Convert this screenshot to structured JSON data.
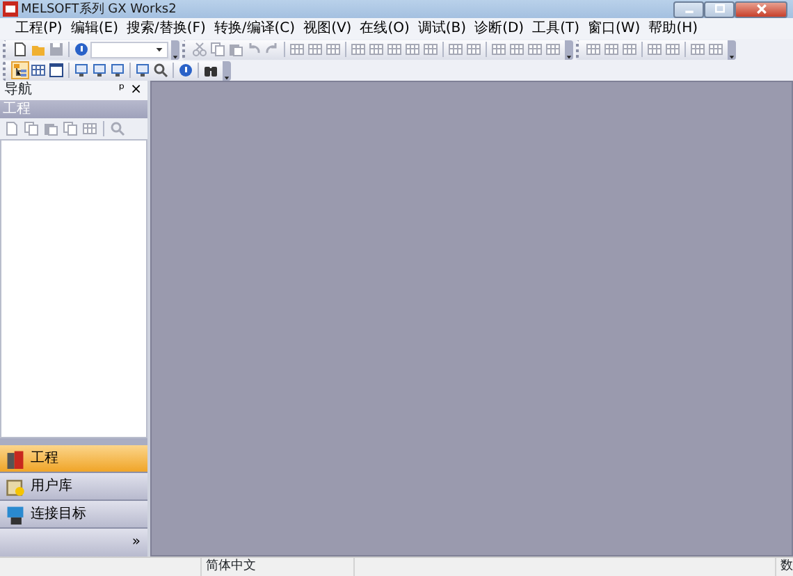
{
  "window": {
    "title": "MELSOFT系列 GX Works2"
  },
  "menu": [
    "工程(P)",
    "编辑(E)",
    "搜索/替换(F)",
    "转换/编译(C)",
    "视图(V)",
    "在线(O)",
    "调试(B)",
    "诊断(D)",
    "工具(T)",
    "窗口(W)",
    "帮助(H)"
  ],
  "toolbar_rows": [
    [
      {
        "items": [
          {
            "kind": "new",
            "disabled": false
          },
          {
            "kind": "open",
            "disabled": false
          },
          {
            "kind": "save",
            "disabled": true
          },
          {
            "kind": "sep"
          },
          {
            "kind": "help",
            "disabled": false
          },
          {
            "kind": "combo"
          }
        ]
      },
      {
        "items": [
          {
            "kind": "cut",
            "disabled": true
          },
          {
            "kind": "copy",
            "disabled": true
          },
          {
            "kind": "paste",
            "disabled": true
          },
          {
            "kind": "undo",
            "disabled": true
          },
          {
            "kind": "redo",
            "disabled": true
          },
          {
            "kind": "sep"
          },
          {
            "kind": "grid",
            "disabled": true
          },
          {
            "kind": "grid",
            "disabled": true
          },
          {
            "kind": "grid",
            "disabled": true
          },
          {
            "kind": "sep"
          },
          {
            "kind": "grid",
            "disabled": true
          },
          {
            "kind": "grid",
            "disabled": true
          },
          {
            "kind": "grid",
            "disabled": true
          },
          {
            "kind": "grid",
            "disabled": true
          },
          {
            "kind": "grid",
            "disabled": true
          },
          {
            "kind": "sep"
          },
          {
            "kind": "grid",
            "disabled": true
          },
          {
            "kind": "grid",
            "disabled": true
          },
          {
            "kind": "sep"
          },
          {
            "kind": "grid",
            "disabled": true
          },
          {
            "kind": "grid",
            "disabled": true
          },
          {
            "kind": "grid",
            "disabled": true
          },
          {
            "kind": "grid",
            "disabled": true
          }
        ]
      },
      {
        "items": [
          {
            "kind": "grid",
            "disabled": true
          },
          {
            "kind": "grid",
            "disabled": true
          },
          {
            "kind": "grid",
            "disabled": true
          },
          {
            "kind": "sep"
          },
          {
            "kind": "grid",
            "disabled": true
          },
          {
            "kind": "grid",
            "disabled": true
          },
          {
            "kind": "sep"
          },
          {
            "kind": "grid",
            "disabled": true
          },
          {
            "kind": "grid",
            "disabled": true
          }
        ]
      }
    ],
    [
      {
        "items": [
          {
            "kind": "tree",
            "disabled": false,
            "selected": true
          },
          {
            "kind": "grid",
            "disabled": false,
            "selected": false
          },
          {
            "kind": "window",
            "disabled": false,
            "selected": false
          },
          {
            "kind": "sep"
          },
          {
            "kind": "monitor",
            "disabled": false,
            "selected": false
          },
          {
            "kind": "monitor",
            "disabled": false,
            "selected": false
          },
          {
            "kind": "monitor",
            "disabled": false,
            "selected": false
          },
          {
            "kind": "sep"
          },
          {
            "kind": "monitor",
            "disabled": false,
            "selected": false
          },
          {
            "kind": "search",
            "disabled": false,
            "selected": false
          },
          {
            "kind": "sep"
          },
          {
            "kind": "help",
            "disabled": false,
            "selected": false
          },
          {
            "kind": "sep"
          },
          {
            "kind": "binoculars",
            "disabled": false,
            "selected": false
          }
        ]
      }
    ]
  ],
  "navigation": {
    "title": "导航",
    "pin": "ᵖ",
    "close": "×",
    "section": "工程",
    "tools": [
      {
        "kind": "new",
        "disabled": true
      },
      {
        "kind": "copy",
        "disabled": true
      },
      {
        "kind": "paste",
        "disabled": true
      },
      {
        "kind": "copy",
        "disabled": true
      },
      {
        "kind": "grid",
        "disabled": true
      },
      {
        "kind": "sep"
      },
      {
        "kind": "search",
        "disabled": true
      }
    ],
    "buttons": [
      {
        "label": "工程",
        "kind": "project",
        "selected": true
      },
      {
        "label": "用户库",
        "kind": "library",
        "selected": false
      },
      {
        "label": "连接目标",
        "kind": "connection",
        "selected": false
      }
    ],
    "more": "»"
  },
  "status_bar": [
    "简体中文",
    "数"
  ]
}
